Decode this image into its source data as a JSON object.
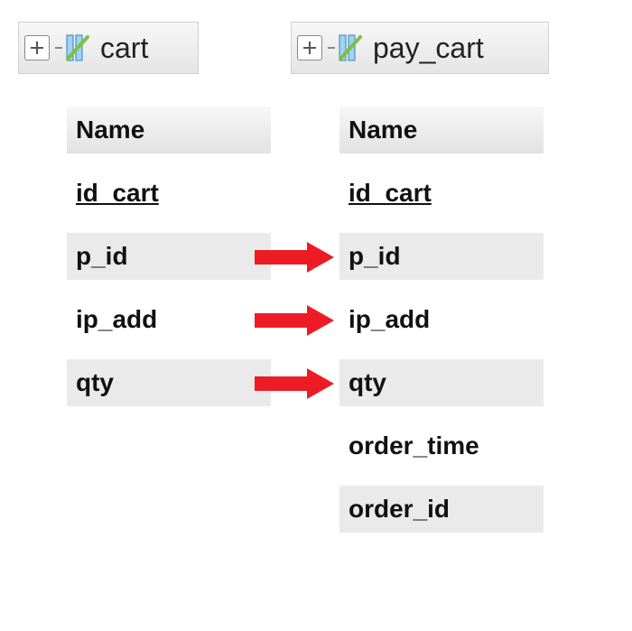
{
  "tables": {
    "left": {
      "title": "cart",
      "header": "Name",
      "columns": [
        {
          "name": "id_cart",
          "pk": true
        },
        {
          "name": "p_id",
          "pk": false
        },
        {
          "name": "ip_add",
          "pk": false
        },
        {
          "name": "qty",
          "pk": false
        }
      ]
    },
    "right": {
      "title": "pay_cart",
      "header": "Name",
      "columns": [
        {
          "name": "id_cart",
          "pk": true
        },
        {
          "name": "p_id",
          "pk": false
        },
        {
          "name": "ip_add",
          "pk": false
        },
        {
          "name": "qty",
          "pk": false
        },
        {
          "name": "order_time",
          "pk": false
        },
        {
          "name": "order_id",
          "pk": false
        }
      ]
    }
  },
  "mappings": [
    {
      "from": "p_id",
      "to": "p_id"
    },
    {
      "from": "ip_add",
      "to": "ip_add"
    },
    {
      "from": "qty",
      "to": "qty"
    }
  ]
}
